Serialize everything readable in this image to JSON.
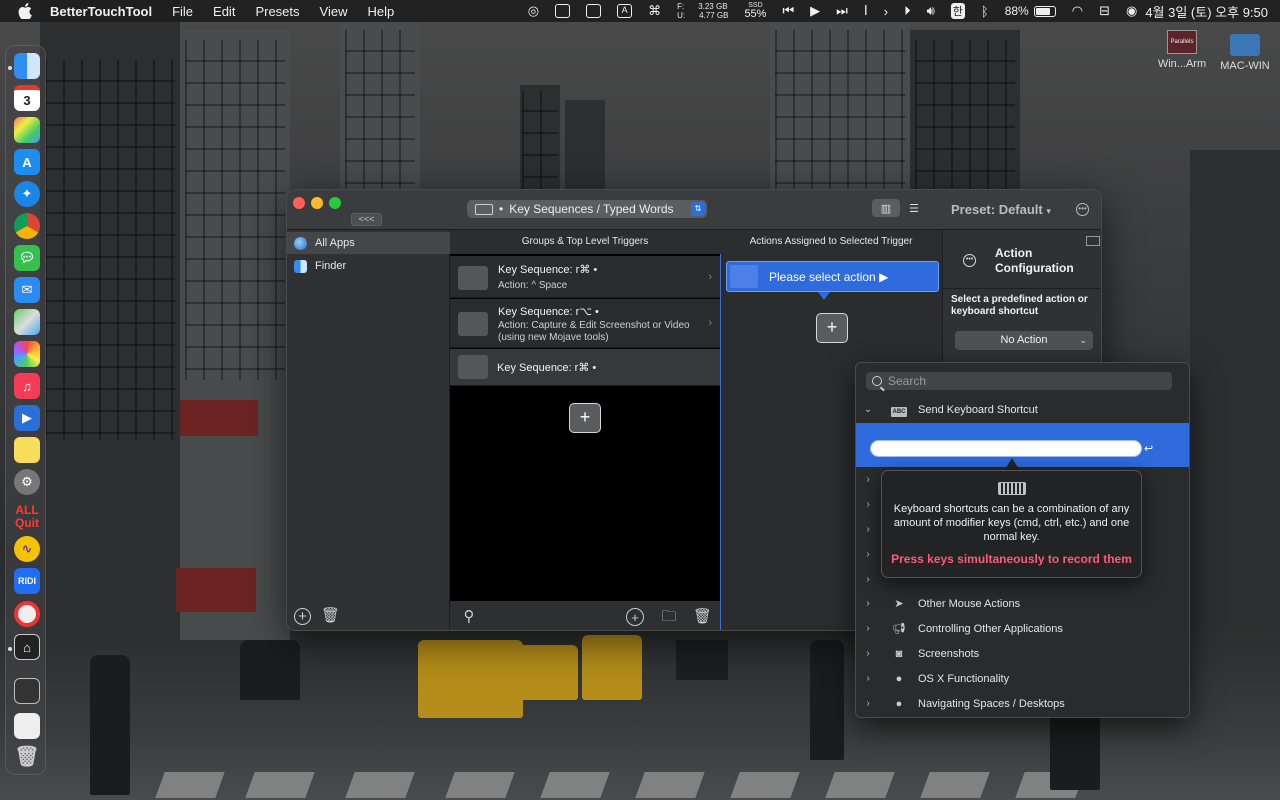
{
  "menubar": {
    "app_name": "BetterTouchTool",
    "menus": [
      "File",
      "Edit",
      "Presets",
      "View",
      "Help"
    ],
    "disk": {
      "free_label": "F:",
      "free": "3.23 GB",
      "used_label": "U:",
      "used": "4.77 GB"
    },
    "ssd": {
      "label": "SSD",
      "value": "55%"
    },
    "input_source": "한",
    "battery": "88%",
    "clock": "4월 3일 (토) 오후 9:50"
  },
  "desktop_icons": [
    {
      "label": "Win...Arm",
      "icon": "parallels-vm-icon",
      "badge": "Parallels"
    },
    {
      "label": "MAC-WIN",
      "icon": "folder-icon"
    }
  ],
  "dock": {
    "items": [
      "finder-icon",
      "calendar-icon",
      "launchpad-icon",
      "app-store-icon",
      "safari-icon",
      "chrome-icon",
      "messages-icon",
      "mail-icon",
      "maps-icon",
      "photos-icon",
      "music-icon",
      "keynote-icon",
      "notes-icon",
      "system-preferences-icon",
      "allquit-icon",
      "vibe-icon",
      "ridi-icon",
      "activity-icon",
      "btt-icon",
      "screen-icon",
      "dictionary-icon",
      "trash-icon"
    ],
    "calendar_day": "3",
    "allquit_label_1": "ALL",
    "allquit_label_2": "Quit",
    "ridi_label": "RIDI"
  },
  "window": {
    "collapse_label": "<<<",
    "trigger_type": "Key Sequences / Typed Words",
    "preset": "Preset: Default",
    "sidebar": [
      {
        "label": "All Apps",
        "icon": "globe-icon",
        "selected": true
      },
      {
        "label": "Finder",
        "icon": "finder-icon",
        "selected": false
      }
    ],
    "col_triggers_header": "Groups & Top Level Triggers",
    "col_actions_header": "Actions Assigned to Selected Trigger",
    "triggers": [
      {
        "title": "Key Sequence: r⌘ •",
        "sub": "Action: ^ Space"
      },
      {
        "title": "Key Sequence: r⌥ •",
        "sub": "Action: Capture & Edit Screenshot or Video (using new Mojave tools)"
      },
      {
        "title": "Key Sequence: r⌘ •",
        "sub": ""
      }
    ],
    "please_select": "Please select action ▶",
    "config": {
      "title_line1": "Action",
      "title_line2": "Configuration",
      "select_label": "Select a predefined action or keyboard shortcut",
      "dropdown_value": "No Action"
    }
  },
  "popup": {
    "search_placeholder": "Search",
    "categories": [
      {
        "label": "Send Keyboard Shortcut",
        "icon": "keyboard-abc-icon"
      },
      {
        "label": "Other Mouse Actions",
        "icon": "cursor-icon"
      },
      {
        "label": "Controlling Other Applications",
        "icon": "megaphone-icon"
      },
      {
        "label": "Screenshots",
        "icon": "camera-icon"
      },
      {
        "label": "OS X Functionality",
        "icon": "apple-icon"
      },
      {
        "label": "Navigating Spaces / Desktops",
        "icon": "apple-icon"
      }
    ],
    "tooltip_text": "Keyboard shortcuts can be a combination of any amount of modifier keys (cmd, ctrl, etc.) and one normal key.",
    "tooltip_warning": "Press keys simultaneously to record them"
  }
}
